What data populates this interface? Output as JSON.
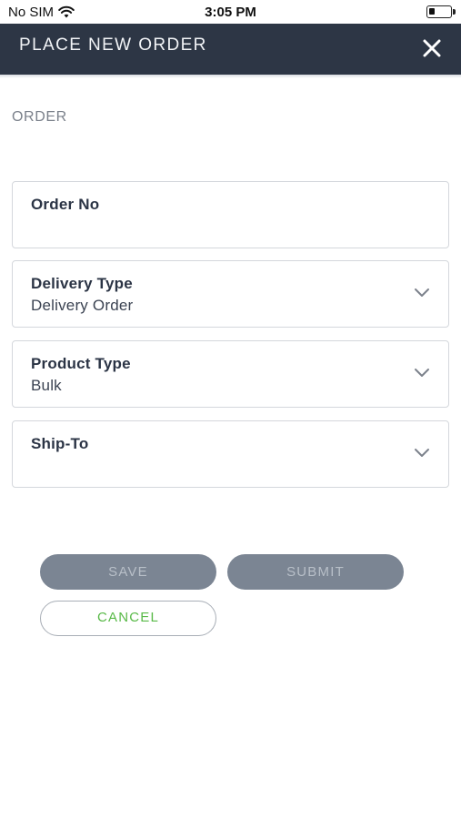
{
  "status_bar": {
    "carrier": "No SIM",
    "time": "3:05 PM",
    "battery_level": 0.3
  },
  "header": {
    "title": "PLACE NEW ORDER",
    "close_icon": "close-icon"
  },
  "section": {
    "label": "ORDER"
  },
  "form": {
    "order_no": {
      "label": "Order No",
      "value": ""
    },
    "delivery_type": {
      "label": "Delivery Type",
      "value": "Delivery Order",
      "icon": "chevron-down-icon"
    },
    "product_type": {
      "label": "Product Type",
      "value": "Bulk",
      "icon": "chevron-down-icon"
    },
    "ship_to": {
      "label": "Ship-To",
      "value": "",
      "icon": "chevron-down-icon"
    }
  },
  "actions": {
    "save_label": "SAVE",
    "submit_label": "SUBMIT",
    "cancel_label": "CANCEL"
  },
  "colors": {
    "header_bg": "#2d3645",
    "disabled_button": "#7b8593",
    "cancel_text": "#58b947"
  }
}
